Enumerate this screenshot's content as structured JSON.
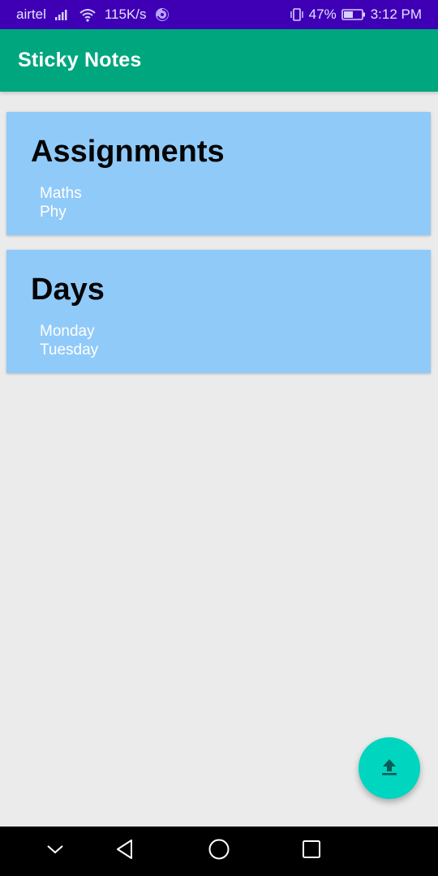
{
  "status_bar": {
    "carrier": "airtel",
    "speed": "115K/s",
    "battery": "47%",
    "time": "3:12 PM",
    "color": "#3f00b5"
  },
  "app_bar": {
    "title": "Sticky Notes",
    "color": "#00a67e"
  },
  "notes": [
    {
      "title": "Assignments",
      "lines": [
        "Maths",
        "Phy"
      ]
    },
    {
      "title": "Days",
      "lines": [
        "Monday",
        "Tuesday"
      ]
    }
  ],
  "note_color": "#90caf9",
  "fab": {
    "icon": "upload-icon",
    "color": "#00d5c0"
  },
  "nav_bar": {
    "icons": [
      "chevron-down-icon",
      "back-icon",
      "home-icon",
      "recents-icon"
    ]
  }
}
